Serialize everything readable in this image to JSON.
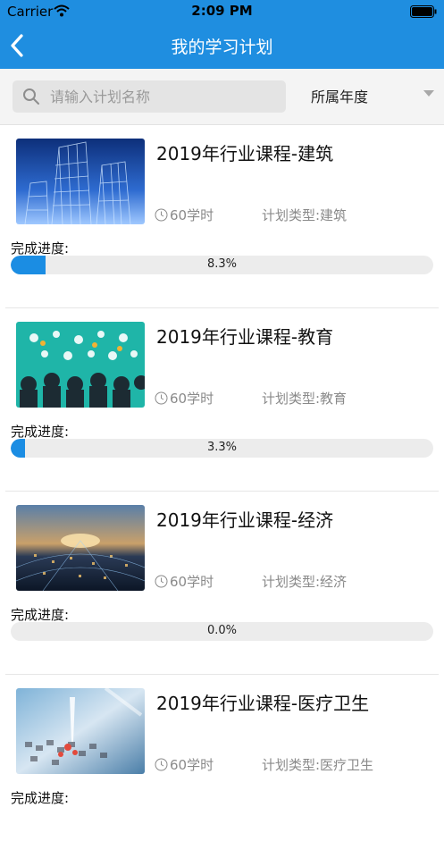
{
  "status": {
    "carrier": "Carrier",
    "time": "2:09 PM"
  },
  "header": {
    "title": "我的学习计划"
  },
  "search": {
    "placeholder": "请输入计划名称",
    "year_label": "所属年度"
  },
  "plans": [
    {
      "title": "2019年行业课程-建筑",
      "hours": "60学时",
      "type": "计划类型:建筑",
      "progress_label": "完成进度:",
      "progress_text": "8.3%",
      "progress": 0.083
    },
    {
      "title": "2019年行业课程-教育",
      "hours": "60学时",
      "type": "计划类型:教育",
      "progress_label": "完成进度:",
      "progress_text": "3.3%",
      "progress": 0.033
    },
    {
      "title": "2019年行业课程-经济",
      "hours": "60学时",
      "type": "计划类型:经济",
      "progress_label": "完成进度:",
      "progress_text": "0.0%",
      "progress": 0.0
    },
    {
      "title": "2019年行业课程-医疗卫生",
      "hours": "60学时",
      "type": "计划类型:医疗卫生",
      "progress_label": "完成进度:",
      "progress_text": "",
      "progress": 0.0
    }
  ],
  "colors": {
    "accent": "#1f8ee0",
    "progress": "#1b8de3"
  }
}
